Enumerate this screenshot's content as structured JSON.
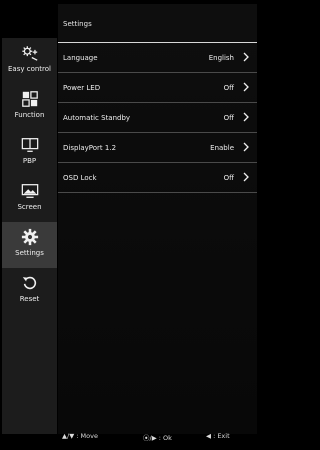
{
  "sidebar": {
    "items": [
      {
        "label": "Easy control",
        "icon": "easy-control-icon"
      },
      {
        "label": "Function",
        "icon": "function-icon"
      },
      {
        "label": "PBP",
        "icon": "pbp-icon"
      },
      {
        "label": "Screen",
        "icon": "screen-icon"
      },
      {
        "label": "Settings",
        "icon": "gear-icon",
        "active": true
      },
      {
        "label": "Reset",
        "icon": "reset-icon"
      }
    ]
  },
  "main": {
    "title": "Settings",
    "rows": [
      {
        "label": "Language",
        "value": "English"
      },
      {
        "label": "Power LED",
        "value": "Off"
      },
      {
        "label": "Automatic Standby",
        "value": "Off"
      },
      {
        "label": "DisplayPort 1.2",
        "value": "Enable"
      },
      {
        "label": "OSD Lock",
        "value": "Off"
      }
    ]
  },
  "footer": {
    "move": "▲/▼ : Move",
    "ok": "⦿/▶ : Ok",
    "exit": "◀ : Exit"
  },
  "colors": {
    "background": "#000000",
    "sidebar": "#1c1c1c",
    "active_item": "#3a3a3a",
    "text": "#efefef",
    "divider": "#4a4a4a"
  }
}
